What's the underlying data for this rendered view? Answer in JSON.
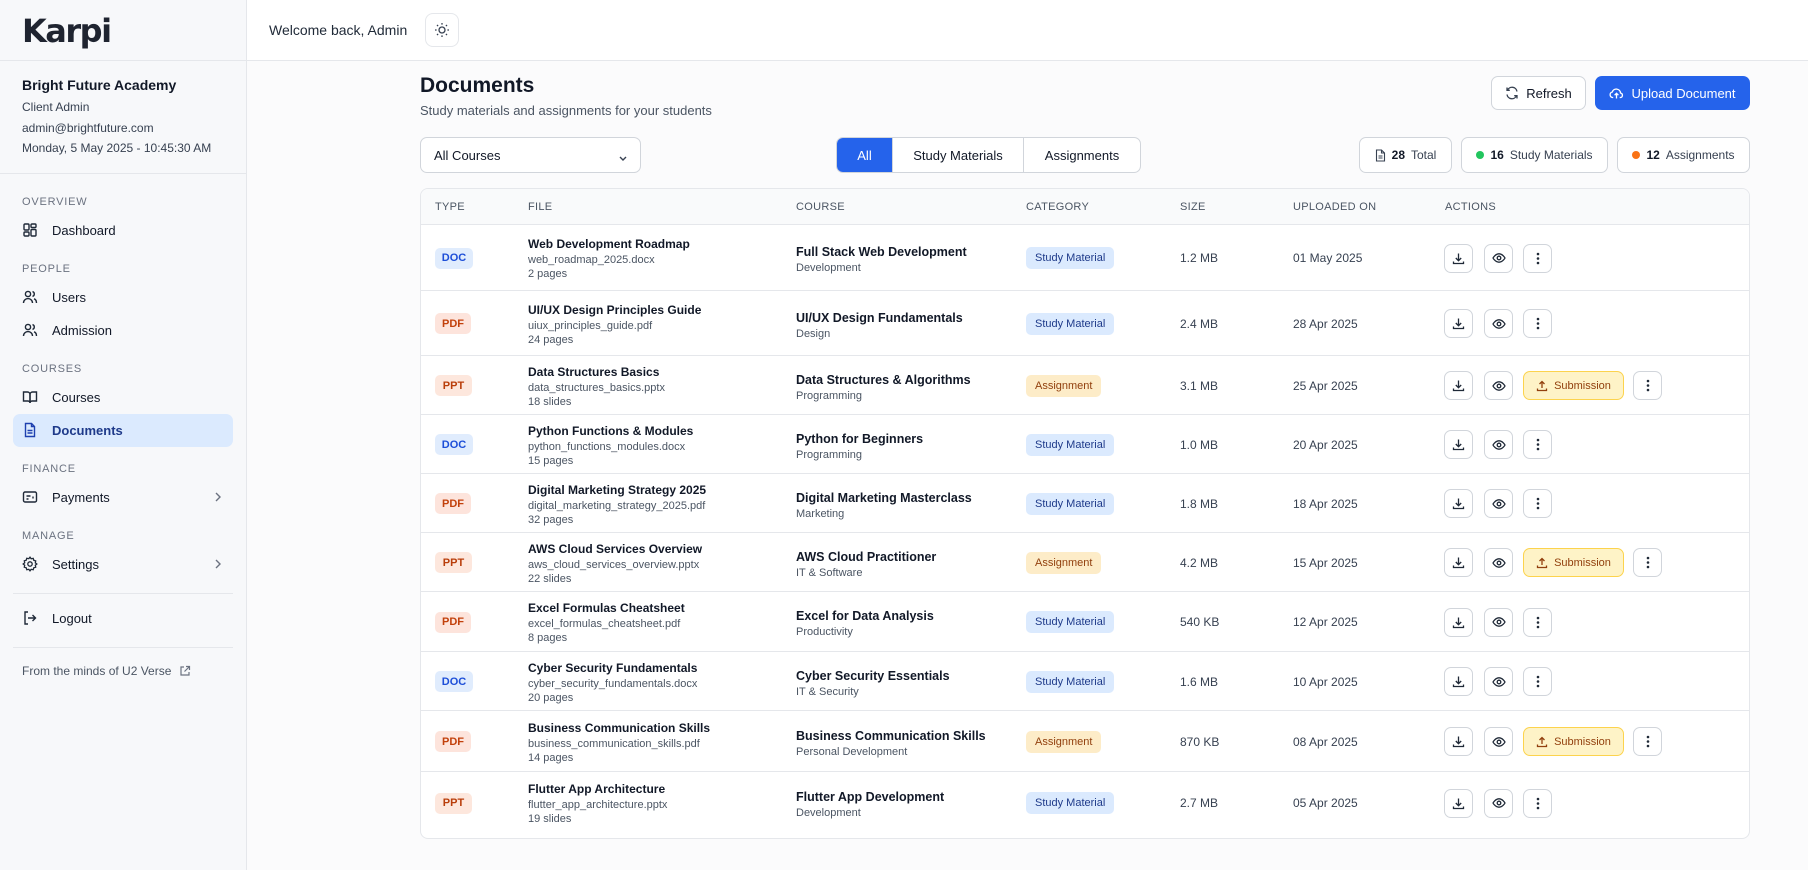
{
  "app": {
    "logo": "Karpi"
  },
  "sidebar": {
    "org_name": "Bright Future Academy",
    "role": "Client Admin",
    "email": "admin@brightfuture.com",
    "datetime": "Monday, 5 May 2025 - 10:45:30 AM",
    "sections": {
      "overview": "OVERVIEW",
      "people": "PEOPLE",
      "courses": "COURSES",
      "finance": "FINANCE",
      "manage": "MANAGE"
    },
    "items": {
      "dashboard": "Dashboard",
      "users": "Users",
      "admission": "Admission",
      "courses": "Courses",
      "documents": "Documents",
      "payments": "Payments",
      "settings": "Settings",
      "logout": "Logout"
    },
    "footer": "From the minds of U2 Verse"
  },
  "header": {
    "welcome": "Welcome back, Admin"
  },
  "main": {
    "title": "Documents",
    "subtitle": "Study materials and assignments for your students",
    "refresh_label": "Refresh",
    "upload_label": "Upload Document",
    "course_filter": "All Courses",
    "tabs": [
      "All",
      "Study Materials",
      "Assignments"
    ],
    "stats": {
      "total_count": "28",
      "total_label": "Total",
      "study_count": "16",
      "study_label": "Study Materials",
      "assign_count": "12",
      "assign_label": "Assignments"
    },
    "columns": [
      "TYPE",
      "FILE",
      "COURSE",
      "CATEGORY",
      "SIZE",
      "UPLOADED ON",
      "ACTIONS"
    ],
    "submission_label": "Submission",
    "rows": [
      {
        "type": "DOC",
        "title": "Web Development Roadmap",
        "file": "web_roadmap_2025.docx",
        "meta": "2 pages",
        "course": "Full Stack Web Development",
        "course_cat": "Development",
        "category": "Study Material",
        "size": "1.2 MB",
        "date": "01 May 2025"
      },
      {
        "type": "PDF",
        "title": "UI/UX Design Principles Guide",
        "file": "uiux_principles_guide.pdf",
        "meta": "24 pages",
        "course": "UI/UX Design Fundamentals",
        "course_cat": "Design",
        "category": "Study Material",
        "size": "2.4 MB",
        "date": "28 Apr 2025"
      },
      {
        "type": "PPT",
        "title": "Data Structures Basics",
        "file": "data_structures_basics.pptx",
        "meta": "18 slides",
        "course": "Data Structures & Algorithms",
        "course_cat": "Programming",
        "category": "Assignment",
        "size": "3.1 MB",
        "date": "25 Apr 2025"
      },
      {
        "type": "DOC",
        "title": "Python Functions & Modules",
        "file": "python_functions_modules.docx",
        "meta": "15 pages",
        "course": "Python for Beginners",
        "course_cat": "Programming",
        "category": "Study Material",
        "size": "1.0 MB",
        "date": "20 Apr 2025"
      },
      {
        "type": "PDF",
        "title": "Digital Marketing Strategy 2025",
        "file": "digital_marketing_strategy_2025.pdf",
        "meta": "32 pages",
        "course": "Digital Marketing Masterclass",
        "course_cat": "Marketing",
        "category": "Study Material",
        "size": "1.8 MB",
        "date": "18 Apr 2025"
      },
      {
        "type": "PPT",
        "title": "AWS Cloud Services Overview",
        "file": "aws_cloud_services_overview.pptx",
        "meta": "22 slides",
        "course": "AWS Cloud Practitioner",
        "course_cat": "IT & Software",
        "category": "Assignment",
        "size": "4.2 MB",
        "date": "15 Apr 2025"
      },
      {
        "type": "PDF",
        "title": "Excel Formulas Cheatsheet",
        "file": "excel_formulas_cheatsheet.pdf",
        "meta": "8 pages",
        "course": "Excel for Data Analysis",
        "course_cat": "Productivity",
        "category": "Study Material",
        "size": "540 KB",
        "date": "12 Apr 2025"
      },
      {
        "type": "DOC",
        "title": "Cyber Security Fundamentals",
        "file": "cyber_security_fundamentals.docx",
        "meta": "20 pages",
        "course": "Cyber Security Essentials",
        "course_cat": "IT & Security",
        "category": "Study Material",
        "size": "1.6 MB",
        "date": "10 Apr 2025"
      },
      {
        "type": "PDF",
        "title": "Business Communication Skills",
        "file": "business_communication_skills.pdf",
        "meta": "14 pages",
        "course": "Business Communication Skills",
        "course_cat": "Personal Development",
        "category": "Assignment",
        "size": "870 KB",
        "date": "08 Apr 2025"
      },
      {
        "type": "PPT",
        "title": "Flutter App Architecture",
        "file": "flutter_app_architecture.pptx",
        "meta": "19 slides",
        "course": "Flutter App Development",
        "course_cat": "Development",
        "category": "Study Material",
        "size": "2.7 MB",
        "date": "05 Apr 2025"
      }
    ]
  },
  "colors": {
    "accent": "#2563eb",
    "doc_badge_bg": "#e0ecfd",
    "doc_badge_fg": "#1d4ed8",
    "pdf_badge_bg": "#fde4dc",
    "pdf_badge_fg": "#c2410c",
    "ppt_badge_bg": "#fde7dd",
    "ppt_badge_fg": "#b93e0b",
    "study_badge_bg": "#dbeafe",
    "study_badge_fg": "#1e3a8a",
    "assign_badge_bg": "#fdecc8",
    "assign_badge_fg": "#92400e",
    "study_dot": "#22c55e",
    "assign_dot": "#f97316"
  }
}
